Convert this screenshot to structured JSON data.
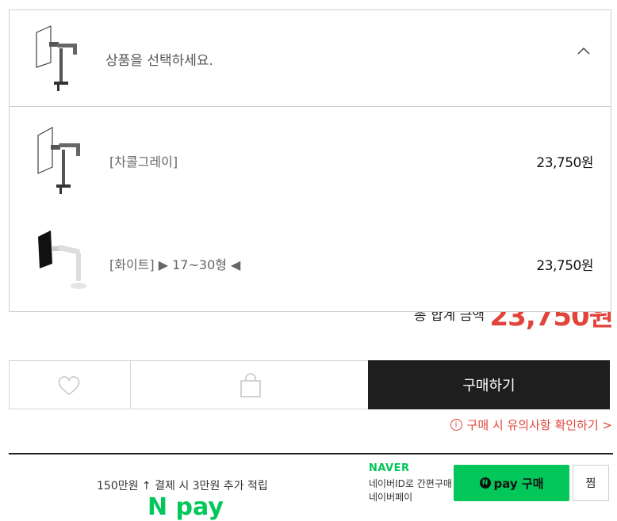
{
  "total": {
    "label": "총 합계 금액",
    "amount": "23,750원"
  },
  "dropdown": {
    "placeholder": "상품을 선택하세요.",
    "options": [
      {
        "label": "[차콜그레이]",
        "price": "23,750원"
      },
      {
        "label": "[화이트] ▶ 17~30형 ◀",
        "price": "23,750원"
      }
    ]
  },
  "actions": {
    "buy_label": "구매하기"
  },
  "notice": {
    "icon": "i",
    "text": "구매 시 유의사항 확인하기 >"
  },
  "npay": {
    "info": "150만원 ↑ 결제 시 3만원 추가 적립",
    "logo_partial": "N pay",
    "brand": "NAVER",
    "line1": "네이버ID로 간편구매",
    "line2": "네이버페이",
    "buy_n": "N",
    "buy_label": "pay 구매",
    "zzim": "찜"
  },
  "colors": {
    "accent_red": "#e0443a",
    "naver_green": "#03c75a",
    "dark": "#1e1e1e"
  }
}
